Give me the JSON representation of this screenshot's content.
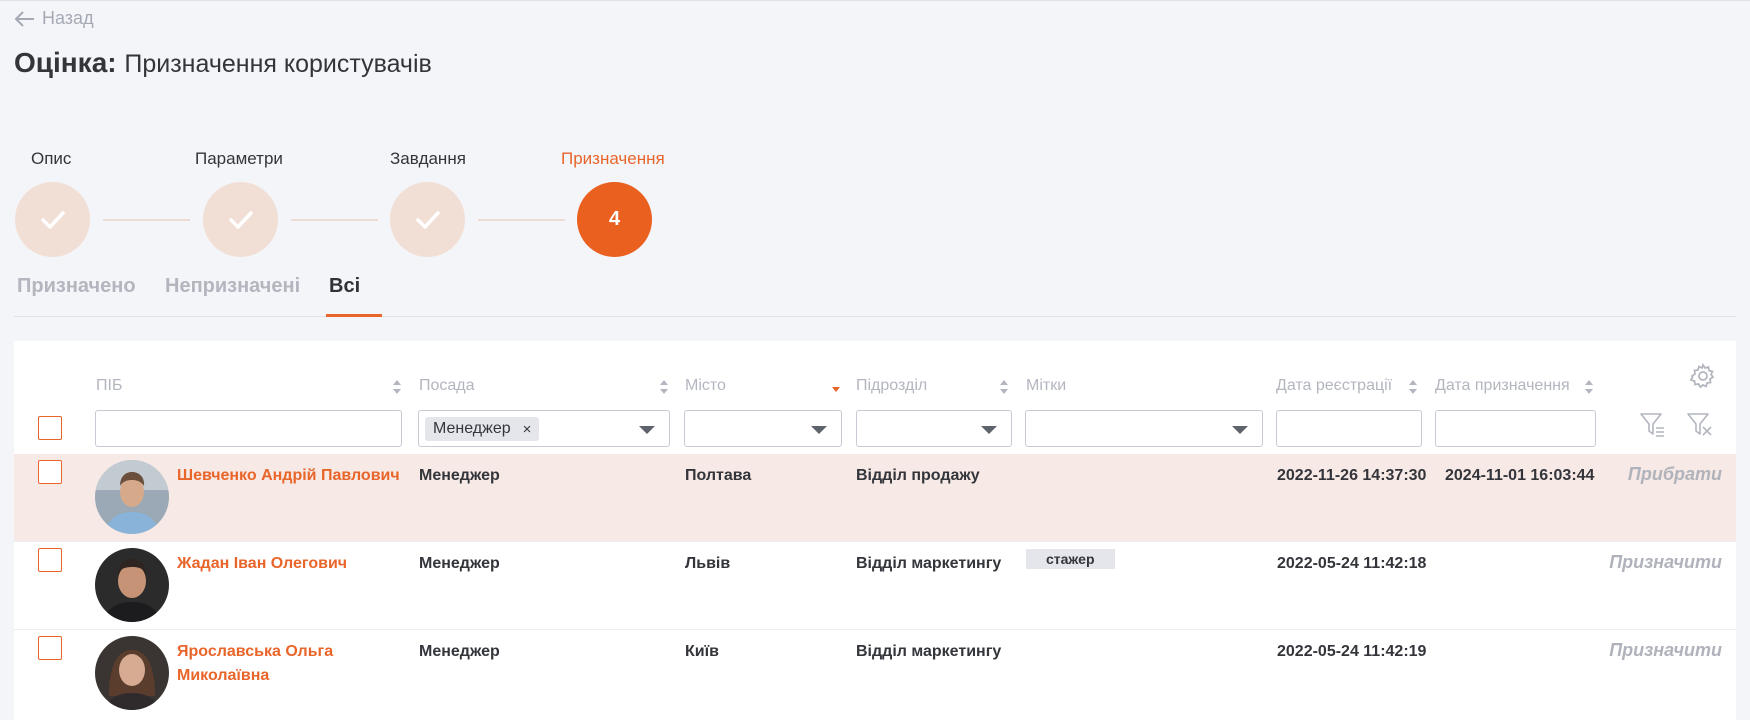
{
  "back_label": "Назад",
  "title": {
    "bold": "Оцінка:",
    "rest": "Призначення користувачів"
  },
  "steps": [
    {
      "label": "Опис",
      "done": true
    },
    {
      "label": "Параметри",
      "done": true
    },
    {
      "label": "Завдання",
      "done": true
    },
    {
      "label": "Призначення",
      "number": "4",
      "active": true
    }
  ],
  "tabs": [
    "Призначено",
    "Непризначені",
    "Всі"
  ],
  "active_tab": "Всі",
  "columns": {
    "name": "ПІБ",
    "position": "Посада",
    "city": "Місто",
    "department": "Підрозділ",
    "tags": "Мітки",
    "reg_date": "Дата реєстрації",
    "assign_date": "Дата призначення"
  },
  "filters": {
    "position_chip": "Менеджер",
    "chip_remove": "×"
  },
  "rows": [
    {
      "name": "Шевченко Андрій Павлович",
      "position": "Менеджер",
      "city": "Полтава",
      "department": "Відділ продажу",
      "tag": "",
      "reg_date": "2022-11-26 14:37:30",
      "assign_date": "2024-11-01 16:03:44",
      "action": "Прибрати"
    },
    {
      "name": "Жадан Іван Олегович",
      "position": "Менеджер",
      "city": "Львів",
      "department": "Відділ маркетингу",
      "tag": "стажер",
      "reg_date": "2022-05-24 11:42:18",
      "assign_date": "",
      "action": "Призначити"
    },
    {
      "name": "Ярославська Ольга Миколаївна",
      "position": "Менеджер",
      "city": "Київ",
      "department": "Відділ маркетингу",
      "tag": "",
      "reg_date": "2022-05-24 11:42:19",
      "assign_date": "",
      "action": "Призначити"
    }
  ],
  "colors": {
    "accent": "#e9652a",
    "highlight_row": "#f7e9e5",
    "done_step": "#f1dfd5"
  }
}
